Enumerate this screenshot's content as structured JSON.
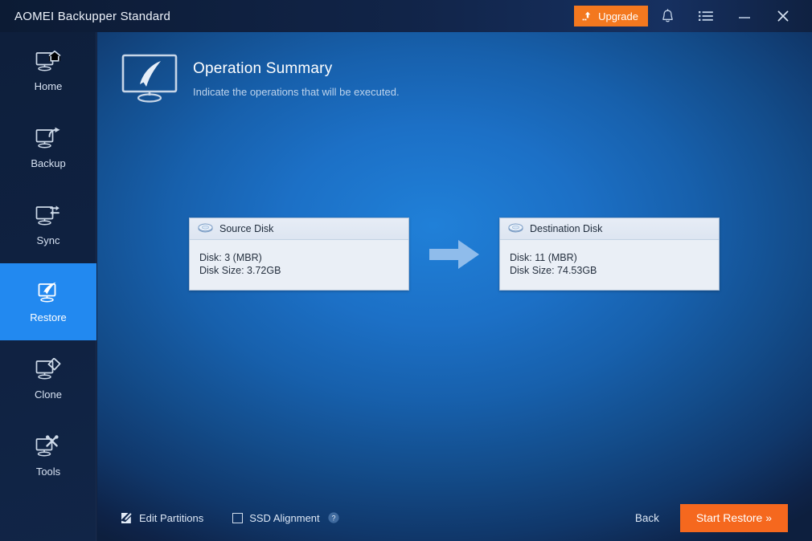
{
  "window": {
    "title": "AOMEI Backupper Standard",
    "upgrade_label": "Upgrade",
    "icons": {
      "upgrade": "upload-arrow-icon",
      "notifications": "bell-icon",
      "menu": "list-menu-icon",
      "minimize": "minimize-icon",
      "close": "close-icon"
    }
  },
  "sidebar": {
    "items": [
      {
        "label": "Home",
        "icon": "monitor-home-icon",
        "active": false
      },
      {
        "label": "Backup",
        "icon": "monitor-share-icon",
        "active": false
      },
      {
        "label": "Sync",
        "icon": "monitor-sync-icon",
        "active": false
      },
      {
        "label": "Restore",
        "icon": "monitor-restore-icon",
        "active": true
      },
      {
        "label": "Clone",
        "icon": "monitor-clone-icon",
        "active": false
      },
      {
        "label": "Tools",
        "icon": "monitor-tools-icon",
        "active": false
      }
    ]
  },
  "header": {
    "icon": "monitor-summary-icon",
    "title": "Operation Summary",
    "subtitle": "Indicate the operations that will be executed."
  },
  "operation": {
    "arrow_icon": "right-arrow-icon",
    "source": {
      "icon": "disk-icon",
      "title": "Source Disk",
      "disk": "Disk: 3 (MBR)",
      "size": "Disk Size: 3.72GB"
    },
    "destination": {
      "icon": "disk-icon",
      "title": "Destination Disk",
      "disk": "Disk: 11 (MBR)",
      "size": "Disk Size: 74.53GB"
    }
  },
  "footer": {
    "edit_partitions_label": "Edit Partitions",
    "edit_partitions_icon": "edit-square-icon",
    "ssd_alignment_label": "SSD Alignment",
    "ssd_alignment_checked": false,
    "help_icon": "help-circle-icon",
    "back_label": "Back",
    "start_label": "Start Restore »"
  },
  "colors": {
    "accent_orange": "#f5681e",
    "upgrade_orange": "#f3781f",
    "active_blue": "#2289f0",
    "titlebar_navy": "#0f2141",
    "arrow_blue": "#8fbceb"
  }
}
